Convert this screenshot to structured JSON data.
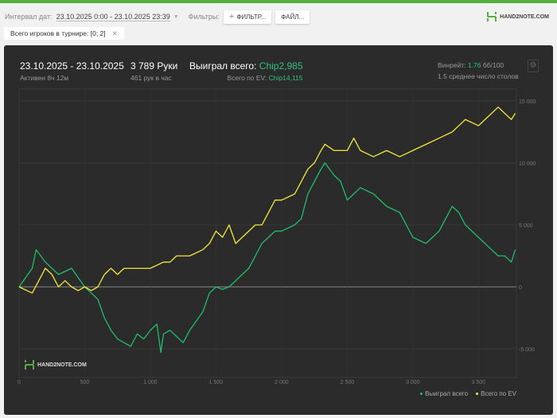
{
  "filters": {
    "interval_label": "Интервал дат:",
    "interval_value": "23.10.2025 0:00 - 23.10.2025 23:39",
    "filters_label": "Фильтры:",
    "filter_button": "ФИЛЬТР...",
    "files_button": "ФАЙЛ...",
    "chip": "Всего игроков в турнире: [0; 2]",
    "logo": "HAND2NOTE.COM"
  },
  "stats": {
    "date_range": "23.10.2025 - 23.10.2025",
    "active": "Активен 8ч 12м",
    "hands": "3 789 Руки",
    "hands_per_hour": "461 рук в час",
    "won_label": "Выиграл всего:",
    "won_value": "Chip2,985",
    "ev_label": "Всего по EV:",
    "ev_value": "Chip14,115",
    "winrate_label": "Винрейт:",
    "winrate_value": "1.76",
    "winrate_unit": "бб/100",
    "tables": "1.5 среднее число столов"
  },
  "colors": {
    "won": "#1fbf6a",
    "ev": "#f2ea3a",
    "accent": "#54b03e"
  },
  "chart_data": {
    "type": "line",
    "xlim": [
      0,
      3789
    ],
    "ylim": [
      -6000,
      15500
    ],
    "x_ticks": [
      "0",
      "500",
      "1 000",
      "1 500",
      "2 000",
      "2 500",
      "3 000",
      "3 500"
    ],
    "y_ticks": [
      "15 000",
      "10 000",
      "5 000",
      "0",
      "-5 000"
    ],
    "grid": true,
    "legend": "bottom-right",
    "series": [
      {
        "name": "Выиграл всего",
        "points": [
          [
            0,
            0
          ],
          [
            100,
            1500
          ],
          [
            130,
            3000
          ],
          [
            200,
            2000
          ],
          [
            300,
            1000
          ],
          [
            400,
            1500
          ],
          [
            500,
            0
          ],
          [
            550,
            -500
          ],
          [
            600,
            -1000
          ],
          [
            650,
            -2500
          ],
          [
            700,
            -3500
          ],
          [
            750,
            -4200
          ],
          [
            800,
            -4500
          ],
          [
            850,
            -4800
          ],
          [
            900,
            -3800
          ],
          [
            950,
            -4200
          ],
          [
            1000,
            -3500
          ],
          [
            1050,
            -3000
          ],
          [
            1080,
            -5300
          ],
          [
            1100,
            -3800
          ],
          [
            1150,
            -3500
          ],
          [
            1250,
            -4500
          ],
          [
            1300,
            -3500
          ],
          [
            1400,
            -2000
          ],
          [
            1450,
            -500
          ],
          [
            1500,
            0
          ],
          [
            1550,
            -200
          ],
          [
            1600,
            0
          ],
          [
            1700,
            1000
          ],
          [
            1750,
            1500
          ],
          [
            1800,
            2500
          ],
          [
            1850,
            3500
          ],
          [
            1900,
            4000
          ],
          [
            1950,
            4500
          ],
          [
            2000,
            4500
          ],
          [
            2100,
            5000
          ],
          [
            2150,
            5500
          ],
          [
            2200,
            7500
          ],
          [
            2250,
            8500
          ],
          [
            2300,
            9500
          ],
          [
            2330,
            10000
          ],
          [
            2400,
            9000
          ],
          [
            2450,
            8500
          ],
          [
            2500,
            7000
          ],
          [
            2550,
            7500
          ],
          [
            2600,
            8000
          ],
          [
            2700,
            7500
          ],
          [
            2800,
            6500
          ],
          [
            2900,
            6000
          ],
          [
            2950,
            5000
          ],
          [
            3000,
            4000
          ],
          [
            3100,
            3500
          ],
          [
            3200,
            4500
          ],
          [
            3300,
            6500
          ],
          [
            3350,
            6000
          ],
          [
            3400,
            5000
          ],
          [
            3500,
            4000
          ],
          [
            3600,
            3000
          ],
          [
            3650,
            2500
          ],
          [
            3700,
            2500
          ],
          [
            3750,
            2000
          ],
          [
            3780,
            3000
          ]
        ]
      },
      {
        "name": "Всего по EV",
        "points": [
          [
            0,
            0
          ],
          [
            100,
            -500
          ],
          [
            150,
            500
          ],
          [
            200,
            1500
          ],
          [
            250,
            1000
          ],
          [
            300,
            0
          ],
          [
            350,
            500
          ],
          [
            400,
            0
          ],
          [
            450,
            -300
          ],
          [
            500,
            0
          ],
          [
            550,
            -300
          ],
          [
            600,
            0
          ],
          [
            650,
            1000
          ],
          [
            700,
            1500
          ],
          [
            750,
            1000
          ],
          [
            800,
            1500
          ],
          [
            900,
            1500
          ],
          [
            1000,
            1500
          ],
          [
            1100,
            2000
          ],
          [
            1150,
            2000
          ],
          [
            1200,
            2500
          ],
          [
            1300,
            2500
          ],
          [
            1400,
            3000
          ],
          [
            1450,
            3500
          ],
          [
            1500,
            4500
          ],
          [
            1550,
            4000
          ],
          [
            1600,
            5000
          ],
          [
            1650,
            3500
          ],
          [
            1700,
            4000
          ],
          [
            1800,
            5000
          ],
          [
            1850,
            5000
          ],
          [
            1900,
            6000
          ],
          [
            1950,
            7000
          ],
          [
            2000,
            7000
          ],
          [
            2100,
            7500
          ],
          [
            2150,
            8500
          ],
          [
            2200,
            9500
          ],
          [
            2250,
            10000
          ],
          [
            2300,
            11000
          ],
          [
            2330,
            11500
          ],
          [
            2400,
            11000
          ],
          [
            2500,
            11000
          ],
          [
            2550,
            12000
          ],
          [
            2600,
            11000
          ],
          [
            2700,
            10500
          ],
          [
            2800,
            11000
          ],
          [
            2900,
            10500
          ],
          [
            3000,
            11000
          ],
          [
            3100,
            11500
          ],
          [
            3200,
            12000
          ],
          [
            3300,
            12500
          ],
          [
            3350,
            13000
          ],
          [
            3400,
            13500
          ],
          [
            3500,
            13000
          ],
          [
            3550,
            13500
          ],
          [
            3600,
            14000
          ],
          [
            3650,
            14500
          ],
          [
            3700,
            14000
          ],
          [
            3750,
            13500
          ],
          [
            3780,
            14000
          ]
        ]
      }
    ]
  }
}
